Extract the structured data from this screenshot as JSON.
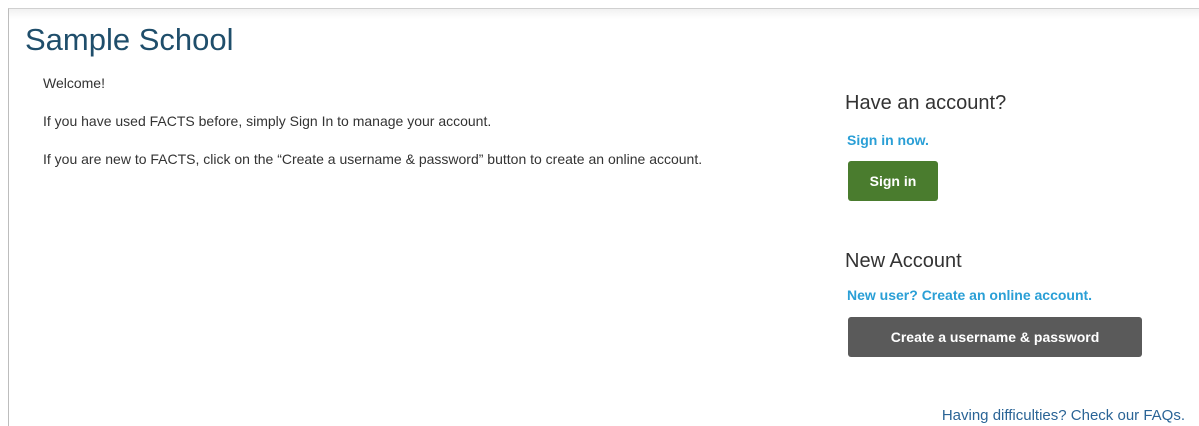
{
  "header": {
    "title": "Sample School"
  },
  "intro": {
    "welcome": "Welcome!",
    "returning_message": "If you have used FACTS before, simply Sign In to manage your account.",
    "new_message": "If you are new to FACTS, click on the “Create a username & password” button to create an online account."
  },
  "existing_account": {
    "heading": "Have an account?",
    "link_text": "Sign in now.",
    "button_label": "Sign in",
    "button_color": "#4a7c2e"
  },
  "new_account": {
    "heading": "New Account",
    "link_text": "New user? Create an online account.",
    "button_label": "Create a username & password",
    "button_color": "#5a5a5a"
  },
  "help": {
    "faq_link": "Having difficulties? Check our FAQs."
  },
  "colors": {
    "title": "#1f4e6b",
    "link": "#2a9fd6",
    "faq_link": "#2a6496"
  }
}
